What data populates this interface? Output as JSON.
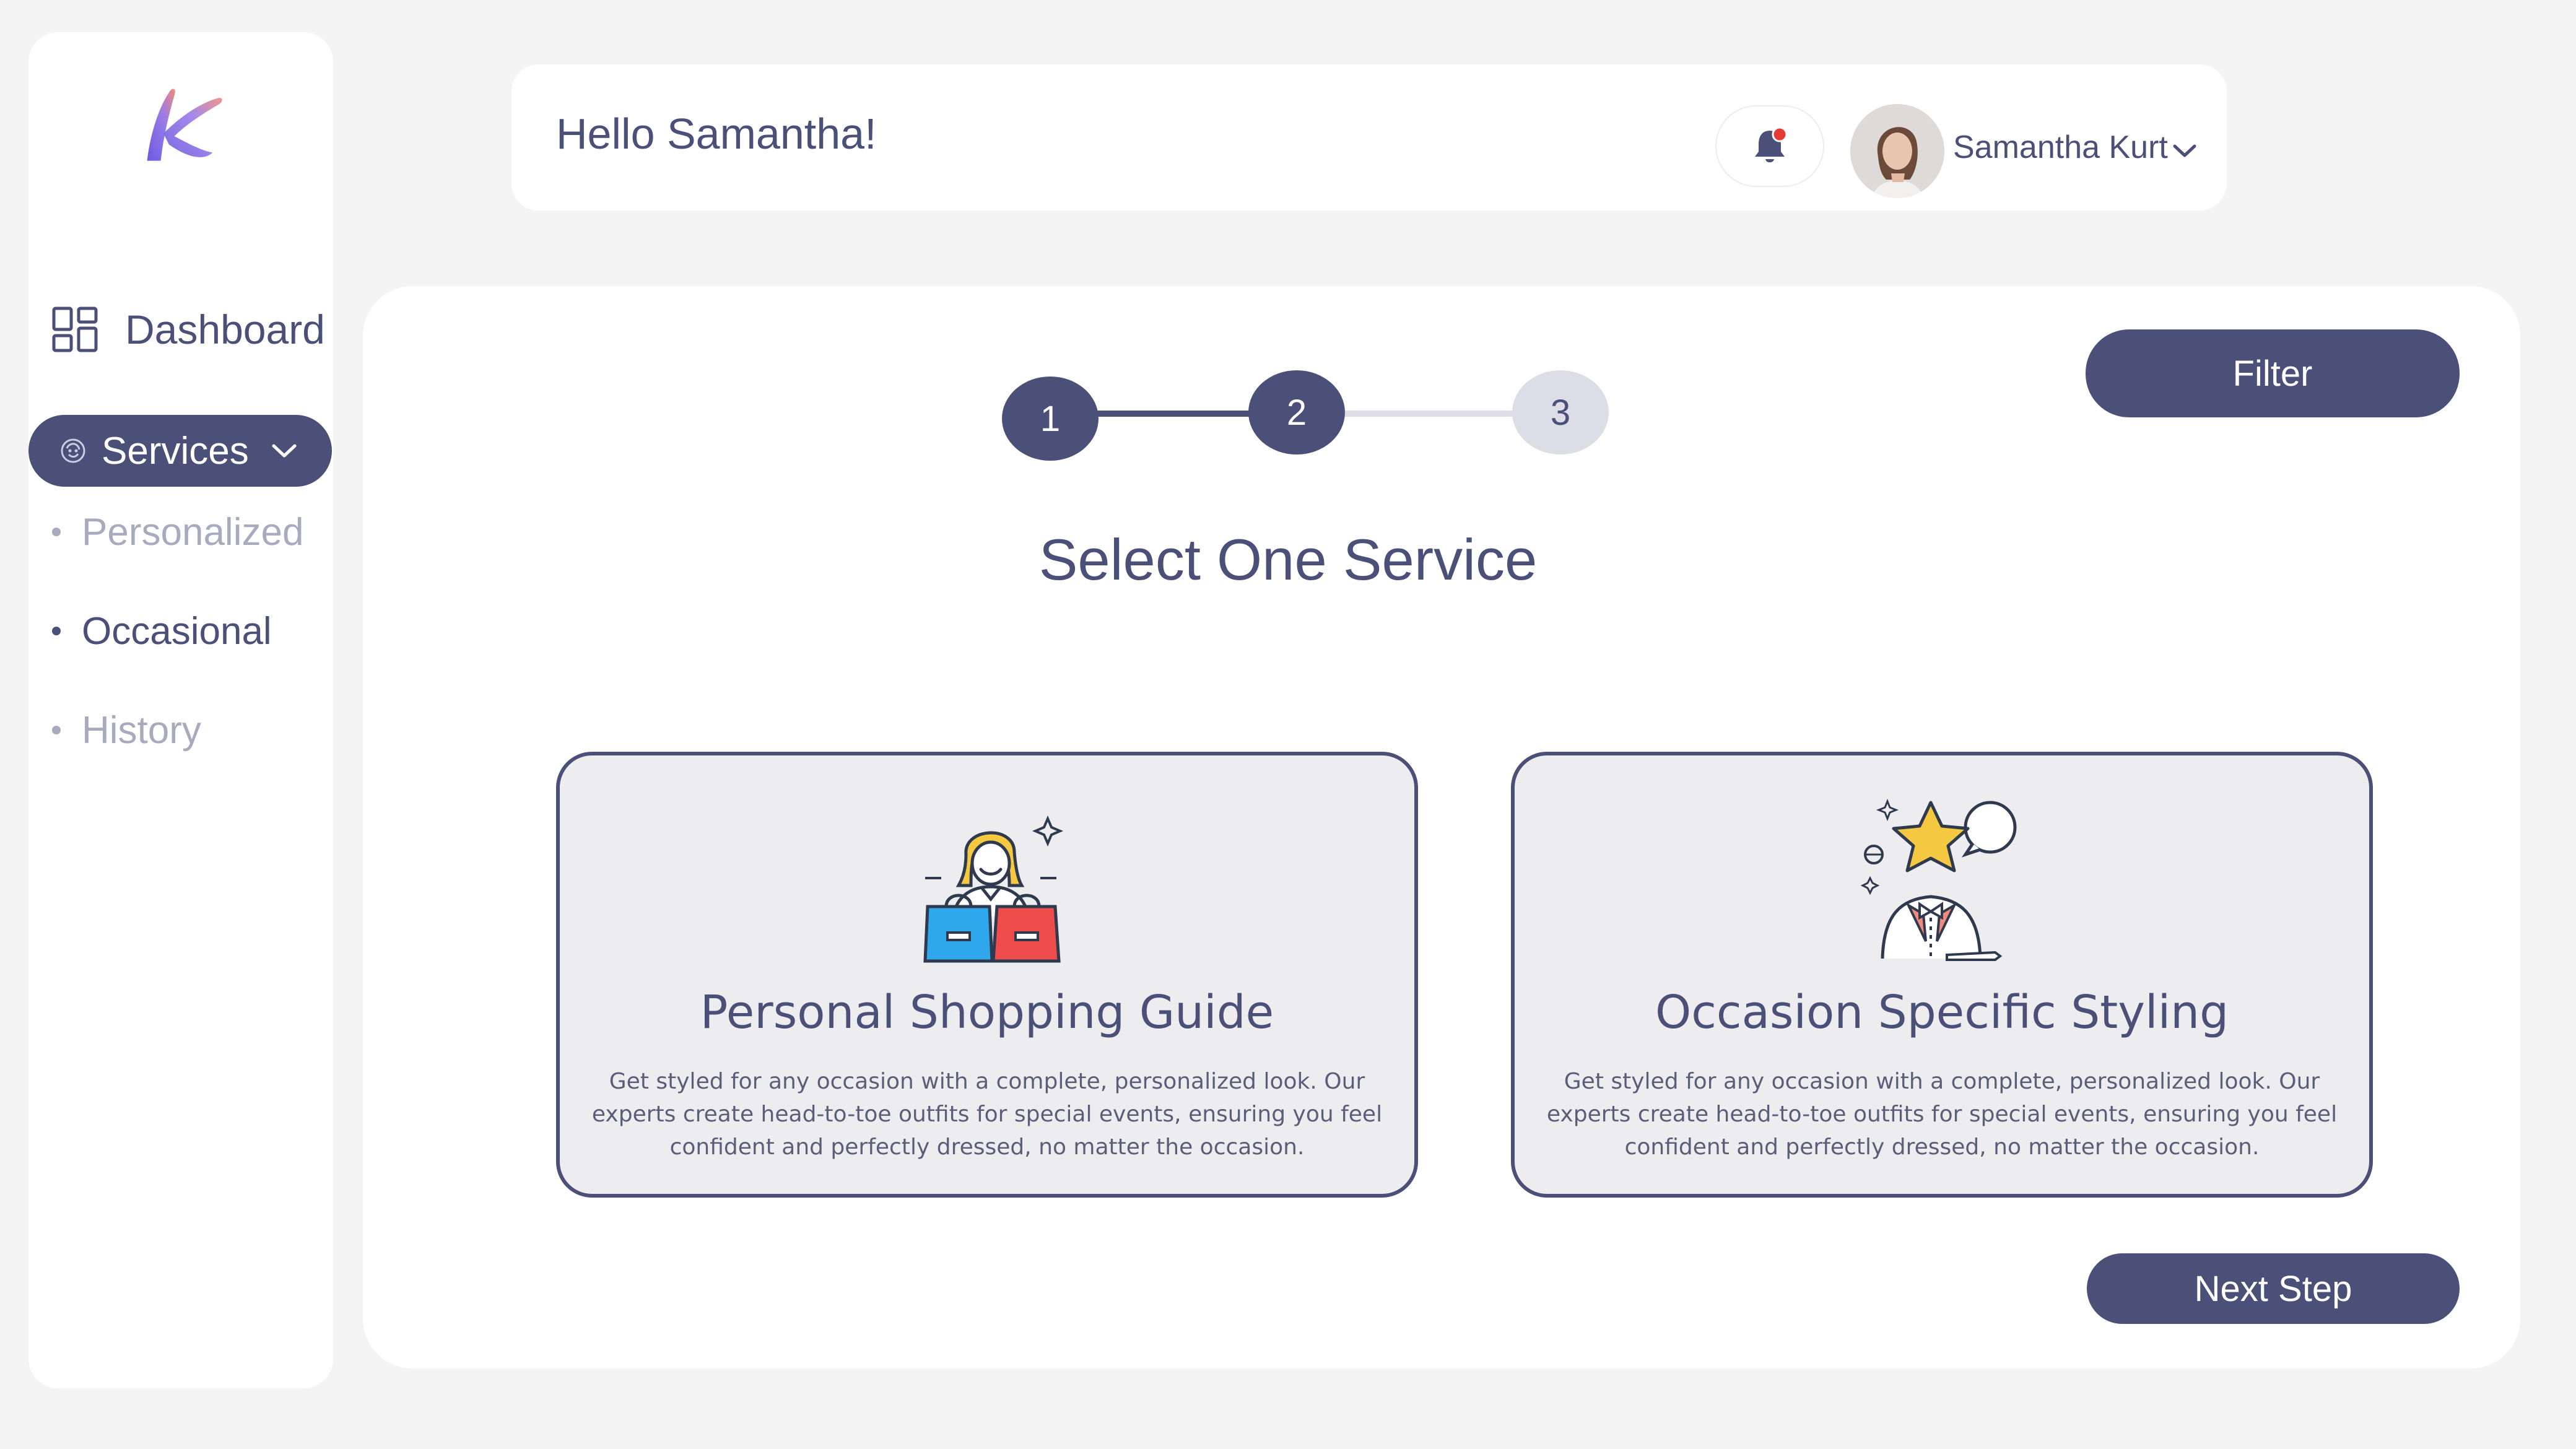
{
  "header": {
    "greeting": "Hello Samantha!",
    "user_name": "Samantha Kurt"
  },
  "sidebar": {
    "items": [
      {
        "label": "Dashboard",
        "icon": "grid-icon"
      },
      {
        "label": "Services",
        "icon": "face-icon",
        "expanded": true
      }
    ],
    "subitems": [
      {
        "label": "Personalized",
        "active": false
      },
      {
        "label": "Occasional",
        "active": true
      },
      {
        "label": "History",
        "active": false
      }
    ]
  },
  "stepper": {
    "steps": [
      "1",
      "2",
      "3"
    ],
    "current": 2
  },
  "main": {
    "filter_label": "Filter",
    "title": "Select One Service",
    "next_label": "Next Step"
  },
  "cards": [
    {
      "title": "Personal Shopping Guide",
      "description": "Get styled for any occasion with a complete, personalized look. Our experts create head-to-toe outfits for special events, ensuring you feel confident and perfectly dressed, no matter the occasion.",
      "icon": "shopping-guide-icon"
    },
    {
      "title": "Occasion Specific Styling",
      "description": "Get styled for any occasion with a complete, personalized look. Our experts create head-to-toe outfits for special events, ensuring you feel confident and perfectly dressed, no matter the occasion.",
      "icon": "occasion-star-icon"
    }
  ],
  "colors": {
    "primary": "#4a5078",
    "background": "#f4f4f4",
    "card_bg": "#ededf0",
    "step_inactive": "#dcdde6",
    "muted_text": "#a7abbd",
    "notification_dot": "#e53935"
  }
}
